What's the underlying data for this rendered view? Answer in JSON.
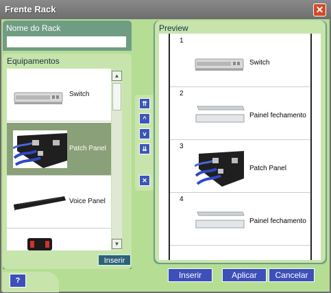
{
  "window": {
    "title": "Frente Rack",
    "close_symbol": "✕"
  },
  "name_section": {
    "label": "Nome do Rack",
    "value": ""
  },
  "equipment": {
    "label": "Equipamentos",
    "items": [
      {
        "label": "Switch",
        "icon": "switch-image",
        "selected": false
      },
      {
        "label": "Patch Panel",
        "icon": "patch-panel-image",
        "selected": true
      },
      {
        "label": "Voice Panel",
        "icon": "voice-panel-image",
        "selected": false
      },
      {
        "label": "",
        "icon": "device-image",
        "selected": false
      }
    ],
    "insert_label": "Inserir"
  },
  "arrows": {
    "top": "⇈",
    "up": "^",
    "down": "v",
    "bottom": "⇊",
    "remove": "✕"
  },
  "preview": {
    "label": "Preview",
    "slots": [
      {
        "number": "1",
        "label": "Switch",
        "icon": "switch-image"
      },
      {
        "number": "2",
        "label": "Painel fechamento",
        "icon": "blank-panel-image"
      },
      {
        "number": "3",
        "label": "Patch Panel",
        "icon": "patch-panel-image"
      },
      {
        "number": "4",
        "label": "Painel fechamento",
        "icon": "blank-panel-image"
      }
    ]
  },
  "footer": {
    "help_label": "?",
    "insert_label": "Inserir",
    "apply_label": "Aplicar",
    "cancel_label": "Cancelar"
  },
  "colors": {
    "panel_bg": "#b5dd93",
    "selection": "#8aa078",
    "button_blue": "#3d4fb8",
    "close_red": "#d24a2b"
  }
}
